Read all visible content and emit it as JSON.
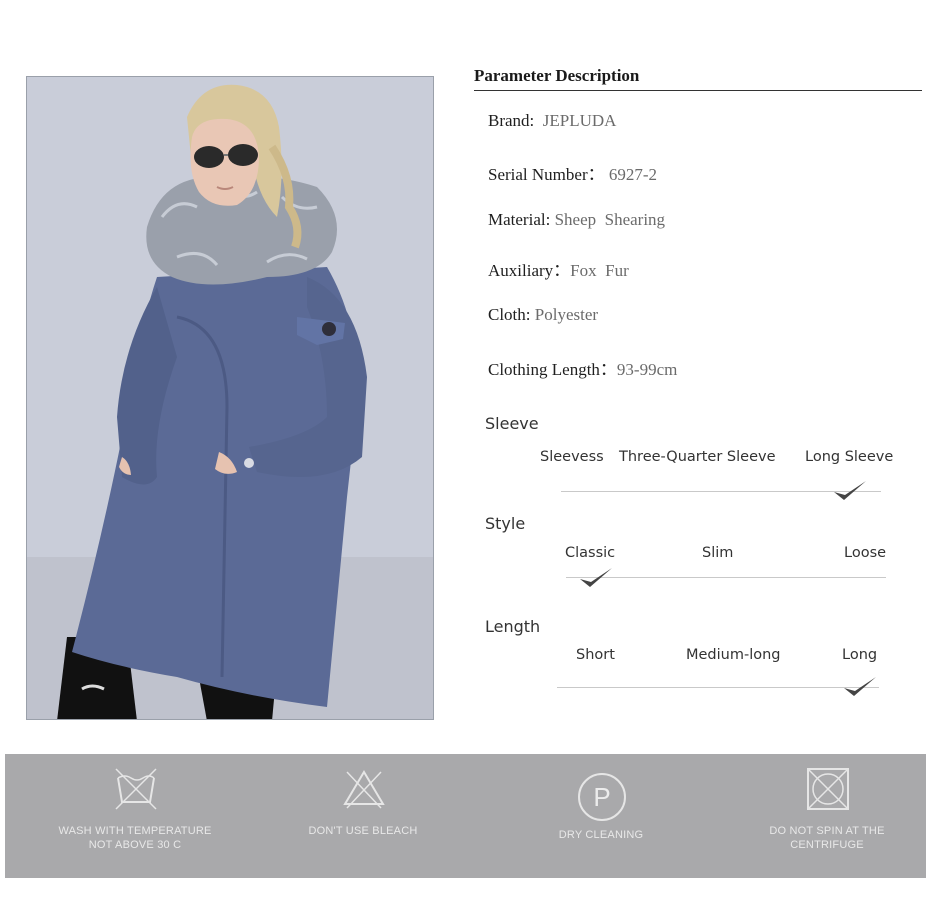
{
  "params": {
    "title": "Parameter Description",
    "rows": [
      {
        "label": "Brand:",
        "value": "JEPLUDA"
      },
      {
        "label": "Serial Number：",
        "value": "6927-2"
      },
      {
        "label": "Material:",
        "value": "Sheep  Shearing"
      },
      {
        "label": "Auxiliary：",
        "value": "Fox  Fur"
      },
      {
        "label": "Cloth:",
        "value": "Polyester"
      },
      {
        "label": "Clothing Length：",
        "value": "93-99cm"
      }
    ]
  },
  "sleeve": {
    "title": "Sleeve",
    "options": [
      "Sleevess",
      "Three-Quarter Sleeve",
      "Long Sleeve"
    ],
    "selected": "Long Sleeve"
  },
  "style": {
    "title": "Style",
    "options": [
      "Classic",
      "Slim",
      "Loose"
    ],
    "selected": "Classic"
  },
  "length": {
    "title": "Length",
    "options": [
      "Short",
      "Medium-long",
      "Long"
    ],
    "selected": "Long"
  },
  "care": [
    {
      "icon": "wash-icon",
      "line1": "WASH WITH TEMPERATURE",
      "line2": "NOT ABOVE 30 C"
    },
    {
      "icon": "no-bleach-icon",
      "line1": "DON'T USE BLEACH",
      "line2": ""
    },
    {
      "icon": "dry-clean-icon",
      "line1": "DRY CLEANING",
      "line2": "",
      "glyph": "P"
    },
    {
      "icon": "no-tumble-dry-icon",
      "line1": "DO NOT SPIN AT THE",
      "line2": "CENTRIFUGE"
    }
  ],
  "colors": {
    "coat": "#5b6a96",
    "fur": "#9aa0ab",
    "care_band": "#a9a9ab",
    "check": "#444444"
  }
}
